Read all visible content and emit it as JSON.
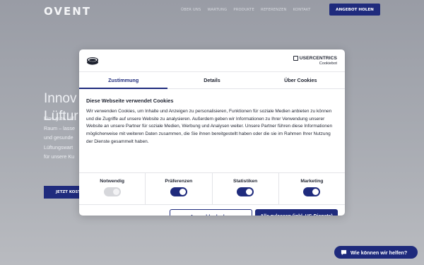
{
  "site": {
    "logo": "OVENT",
    "nav": [
      "ÜBER UNS",
      "WARTUNG",
      "PRODUKTE",
      "REFERENZEN",
      "KONTAKT"
    ],
    "nav_cta": "ANGEBOT HOLEN",
    "hero_title_lines": [
      "Innov",
      "Lüftur"
    ],
    "hero_text_lines": [
      "Eine gute Lüf",
      "Raum – lasse",
      "und gesunde",
      "Lüftungswart",
      "für unsere Ku"
    ],
    "hero_button": "JETZT KOST"
  },
  "chat_button": {
    "label": "Wie können wir helfen?",
    "icon": "chat-bubble-icon"
  },
  "consent": {
    "brand_name": "USERCENTRICS",
    "brand_sub": "Cookiebot",
    "tabs": [
      {
        "label": "Zustimmung",
        "active": true
      },
      {
        "label": "Details",
        "active": false
      },
      {
        "label": "Über Cookies",
        "active": false
      }
    ],
    "heading": "Diese Webseite verwendet Cookies",
    "text": "Wir verwenden Cookies, um Inhalte und Anzeigen zu personalisieren, Funktionen für soziale Medien anbieten zu können und die Zugriffe auf unsere Website zu analysieren. Außerdem geben wir Informationen zu Ihrer Verwendung unserer Website an unsere Partner für soziale Medien, Werbung und Analysen weiter. Unsere Partner führen diese Informationen möglicherweise mit weiteren Daten zusammen, die Sie ihnen bereitgestellt haben oder die sie im Rahmen Ihrer Nutzung der Dienste gesammelt haben.",
    "toggles": [
      {
        "label": "Notwendig",
        "state": "on-disabled"
      },
      {
        "label": "Präferenzen",
        "state": "on"
      },
      {
        "label": "Statistiken",
        "state": "on"
      },
      {
        "label": "Marketing",
        "state": "on"
      }
    ],
    "allow_selection": "Auswahl erlauben",
    "allow_all": "Alle zulassen (inkl. US-Dienste)"
  },
  "colors": {
    "brand": "#1f2b7d",
    "backdrop": "#9a9da6"
  }
}
